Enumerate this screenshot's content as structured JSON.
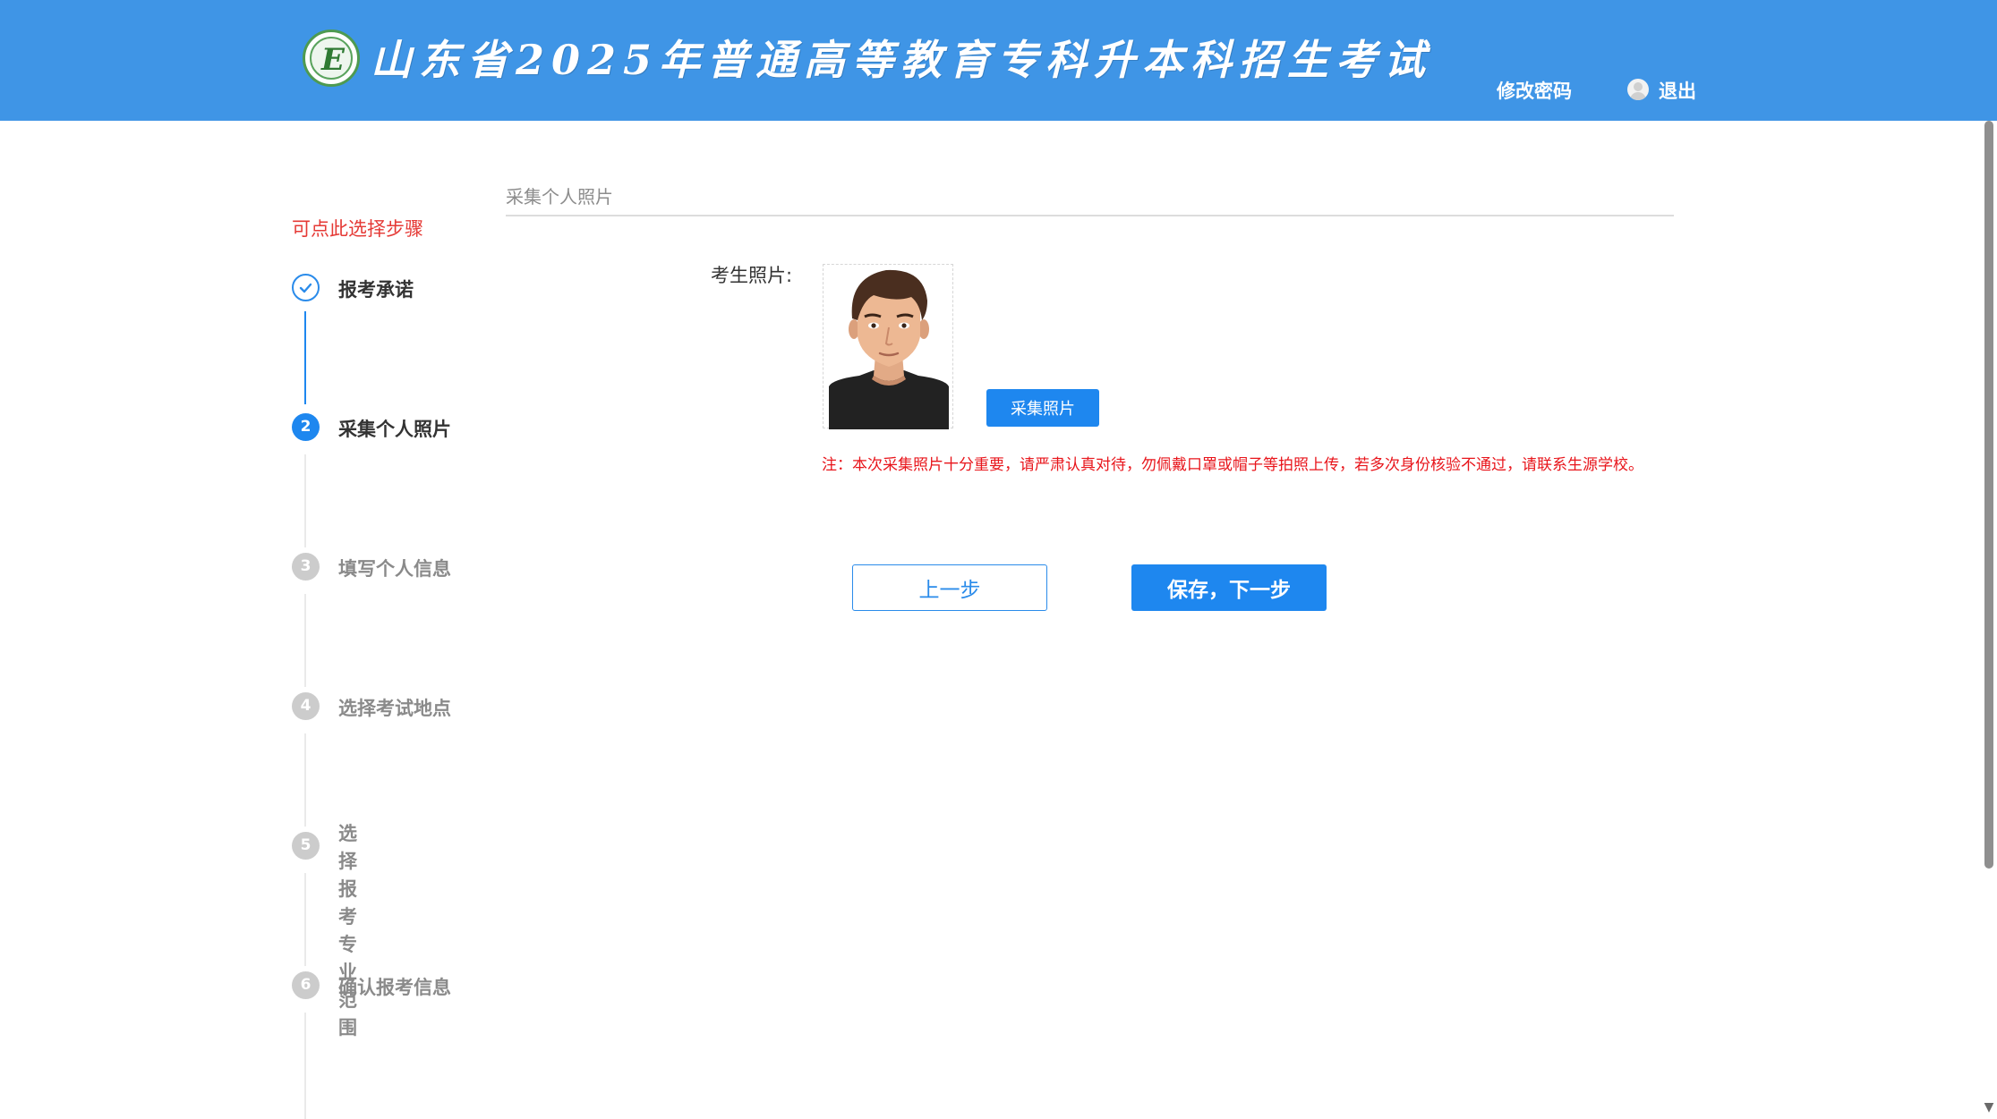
{
  "header": {
    "title": "山东省2025年普通高等教育专科升本科招生考试",
    "change_password": "修改密码",
    "logout": "退出",
    "background_color": "#3f95e6",
    "logo_letter": "E"
  },
  "sidebar": {
    "hint": "可点此选择步骤",
    "steps": [
      {
        "number": "",
        "label": "报考承诺",
        "status": "done"
      },
      {
        "number": "2",
        "label": "采集个人照片",
        "status": "active"
      },
      {
        "number": "3",
        "label": "填写个人信息",
        "status": "todo"
      },
      {
        "number": "4",
        "label": "选择考试地点",
        "status": "todo"
      },
      {
        "number": "5",
        "label": "选择报考专业\n范围",
        "status": "todo"
      },
      {
        "number": "6",
        "label": "确认报考信息",
        "status": "todo"
      }
    ]
  },
  "main": {
    "section_title": "采集个人照片",
    "photo_label": "考生照片:",
    "collect_button": "采集照片",
    "notice": "注：本次采集照片十分重要，请严肃认真对待，勿佩戴口罩或帽子等拍照上传，若多次身份核验不通过，请联系生源学校。",
    "prev_button": "上一步",
    "next_button": "保存，下一步"
  },
  "colors": {
    "accent": "#1e87ef",
    "warning": "#e8151b",
    "inactive": "#cccccc"
  },
  "icons": [
    "check-icon",
    "user-icon",
    "portrait-placeholder"
  ]
}
